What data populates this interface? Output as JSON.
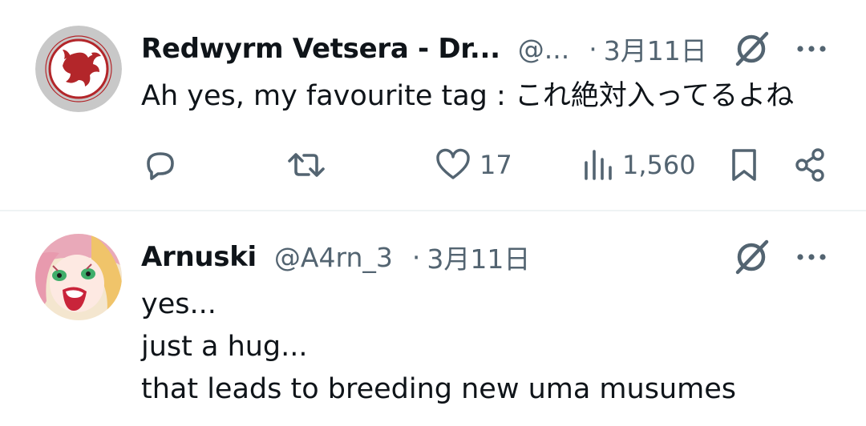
{
  "tweets": [
    {
      "author": "Redwyrm Vetsera - Dr...",
      "handle": "@...",
      "dot": "·",
      "date": "3月11日",
      "text_lines": [
        "Ah yes, my favourite tag : これ絶対入ってるよね"
      ],
      "actions": {
        "reply_count": "",
        "retweet_count": "",
        "like_count": "17",
        "view_count": "1,560"
      }
    },
    {
      "author": "Arnuski",
      "handle": "@A4rn_3",
      "dot": "·",
      "date": "3月11日",
      "text_lines": [
        "yes...",
        "just a hug...",
        "that leads to breeding new uma musumes"
      ]
    }
  ],
  "colors": {
    "text_primary": "#0f1419",
    "text_secondary": "#536471",
    "divider": "#eff3f4",
    "avatar1_bg": "#c8c8c8",
    "avatar1_emblem": "#b3262a"
  },
  "icons": [
    "reply-icon",
    "retweet-icon",
    "like-icon",
    "views-icon",
    "bookmark-icon",
    "share-icon",
    "grok-icon",
    "more-icon"
  ]
}
